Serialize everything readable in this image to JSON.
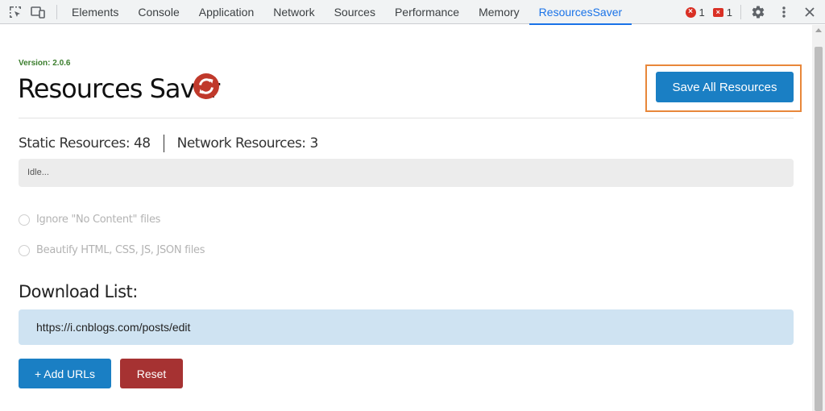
{
  "devtools": {
    "tabs": [
      "Elements",
      "Console",
      "Application",
      "Network",
      "Sources",
      "Performance",
      "Memory",
      "ResourcesSaver"
    ],
    "active_tab": "ResourcesSaver",
    "error_count": "1",
    "issue_count": "1",
    "accent_color": "#1a73e8"
  },
  "header": {
    "version": "Version: 2.0.6",
    "title": "Resources Saver",
    "save_all_label": "Save All Resources",
    "refresh_icon": "refresh-icon"
  },
  "counts": {
    "static": "Static Resources: 48",
    "network": "Network Resources: 3"
  },
  "status": "Idle...",
  "options": {
    "ignore_no_content": "Ignore \"No Content\" files",
    "beautify": "Beautify HTML, CSS, JS, JSON files"
  },
  "download": {
    "title": "Download List:",
    "urls": [
      "https://i.cnblogs.com/posts/edit"
    ],
    "add_label": "+ Add URLs",
    "reset_label": "Reset"
  },
  "colors": {
    "primary": "#1a7fc4",
    "danger": "#a63232",
    "highlight": "#e8873a",
    "version": "#3a7d2c"
  }
}
